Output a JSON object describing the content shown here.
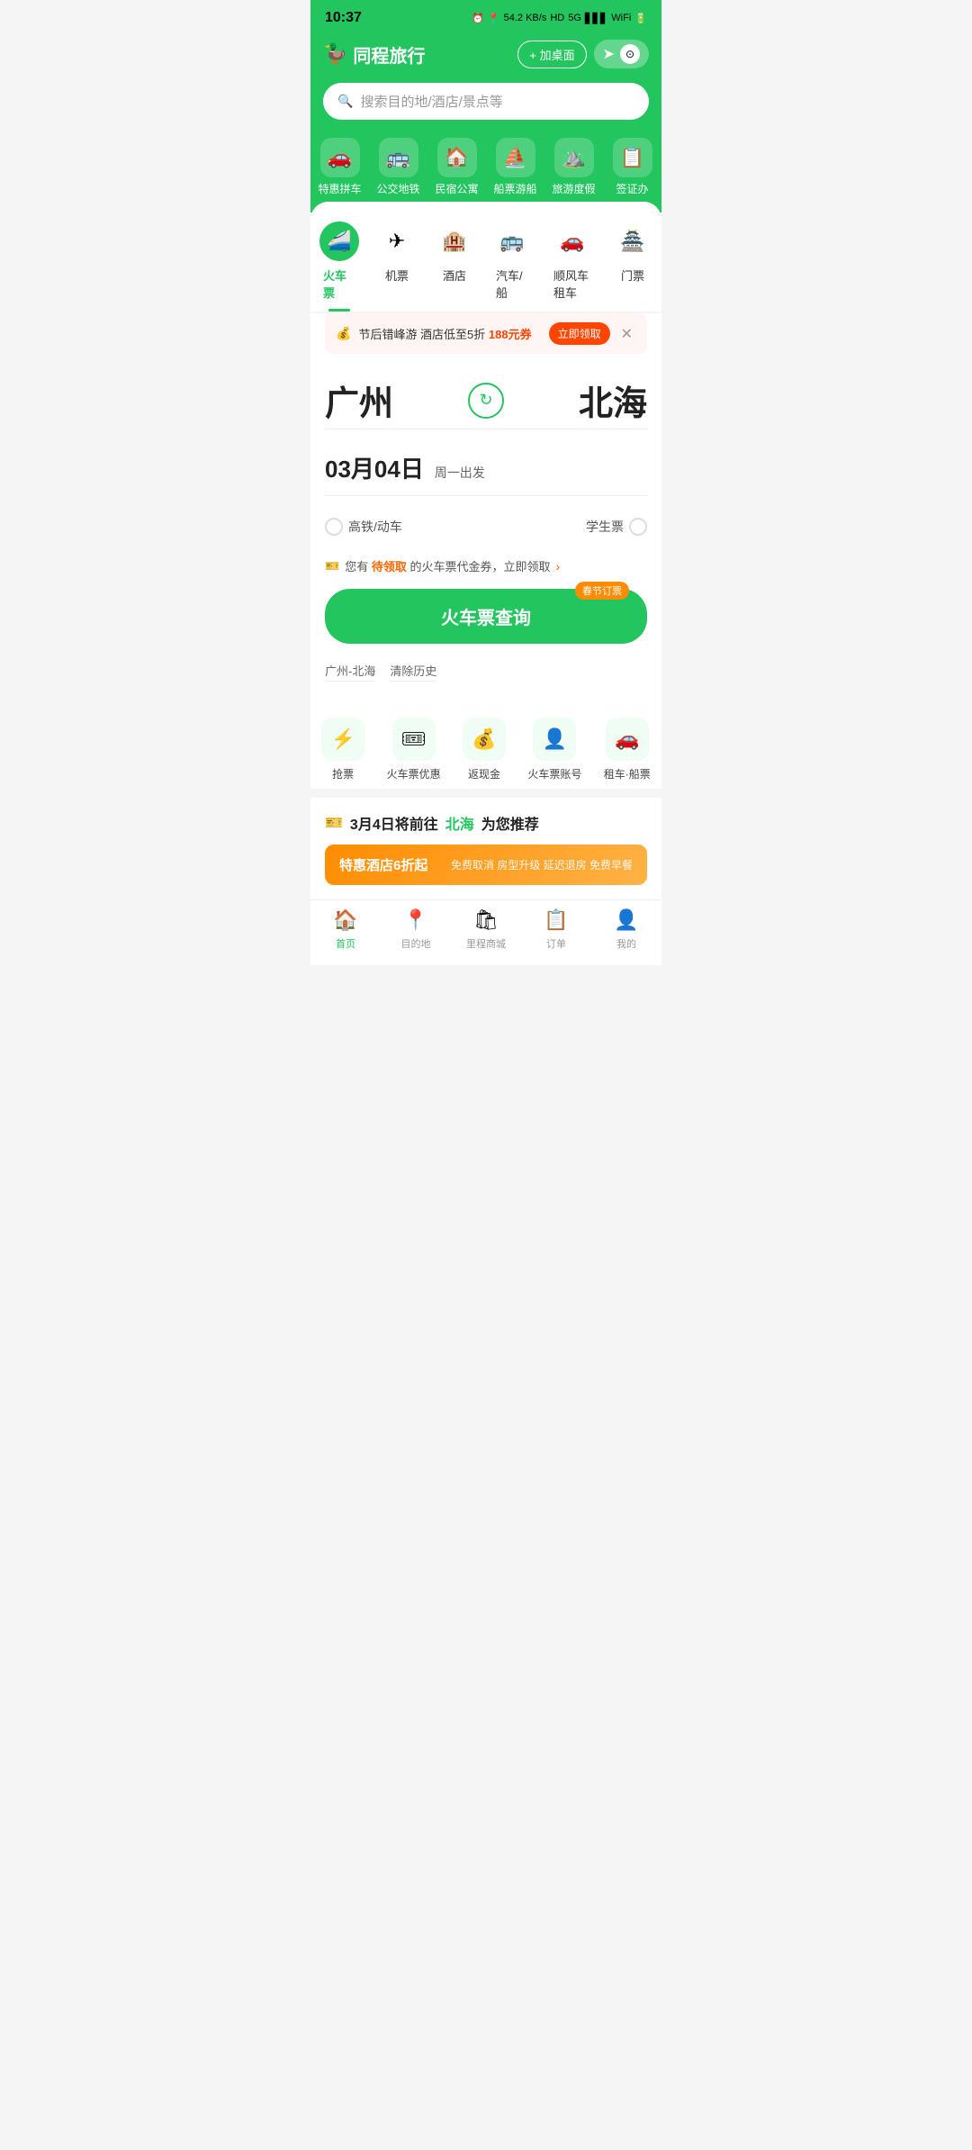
{
  "statusBar": {
    "time": "10:37",
    "network": "54.2 KB/s",
    "format": "HD",
    "signal": "5G"
  },
  "header": {
    "logoText": "同程旅行",
    "addDeskLabel": "+ 加桌面",
    "locationArrow": "➤",
    "cameraIcon": "⊙"
  },
  "search": {
    "placeholder": "搜索目的地/酒店/景点等"
  },
  "navIcons": [
    {
      "icon": "🚗",
      "label": "特惠拼车"
    },
    {
      "icon": "🚌",
      "label": "公交地铁"
    },
    {
      "icon": "🏠",
      "label": "民宿公寓"
    },
    {
      "icon": "⛵",
      "label": "船票游船"
    },
    {
      "icon": "⛰",
      "label": "旅游度假"
    },
    {
      "icon": "📋",
      "label": "签证办"
    }
  ],
  "transportTabs": [
    {
      "icon": "🚄",
      "label": "火车票",
      "active": true
    },
    {
      "icon": "✈",
      "label": "机票",
      "active": false
    },
    {
      "icon": "🏨",
      "label": "酒店",
      "active": false
    },
    {
      "icon": "🚌",
      "label": "汽车/船",
      "active": false
    },
    {
      "icon": "🚗",
      "label": "顺风车租车",
      "active": false
    },
    {
      "icon": "🏯",
      "label": "门票",
      "active": false
    }
  ],
  "promo": {
    "icon": "💰",
    "text": "节后错峰游 酒店低至5折",
    "highlight": "188元券",
    "btnLabel": "立即领取"
  },
  "route": {
    "from": "广州",
    "to": "北海",
    "swapIcon": "⟳"
  },
  "date": {
    "main": "03月04日",
    "sub": "周一出发"
  },
  "options": {
    "leftLabel": "高铁/动车",
    "rightLabel": "学生票"
  },
  "coupon": {
    "icon": "🎫",
    "text1": "您有",
    "highlight": "待领取",
    "text2": "的火车票代金券，立即领取"
  },
  "searchBtn": {
    "label": "火车票查询",
    "badge": "春节订票"
  },
  "history": [
    {
      "label": "广州-北海"
    },
    {
      "label": "清除历史"
    }
  ],
  "quickActions": [
    {
      "icon": "⚡",
      "label": "抢票"
    },
    {
      "icon": "🎟",
      "label": "火车票优惠"
    },
    {
      "icon": "💰",
      "label": "返现金"
    },
    {
      "icon": "👤",
      "label": "火车票账号"
    },
    {
      "icon": "🚗",
      "label": "租车·船票"
    }
  ],
  "recommend": {
    "icon": "🎫",
    "textBefore": "3月4日将前往",
    "highlight": "北海",
    "textAfter": "为您推荐"
  },
  "hotelPromo": {
    "leftText": "特惠酒店6折起",
    "rightText": "免费取消 房型升级 延迟退房 免费早餐"
  },
  "bottomNav": [
    {
      "icon": "🏠",
      "label": "首页",
      "active": true
    },
    {
      "icon": "📍",
      "label": "目的地",
      "active": false
    },
    {
      "icon": "🛍",
      "label": "里程商城",
      "active": false
    },
    {
      "icon": "📋",
      "label": "订单",
      "active": false
    },
    {
      "icon": "👤",
      "label": "我的",
      "active": false
    }
  ]
}
